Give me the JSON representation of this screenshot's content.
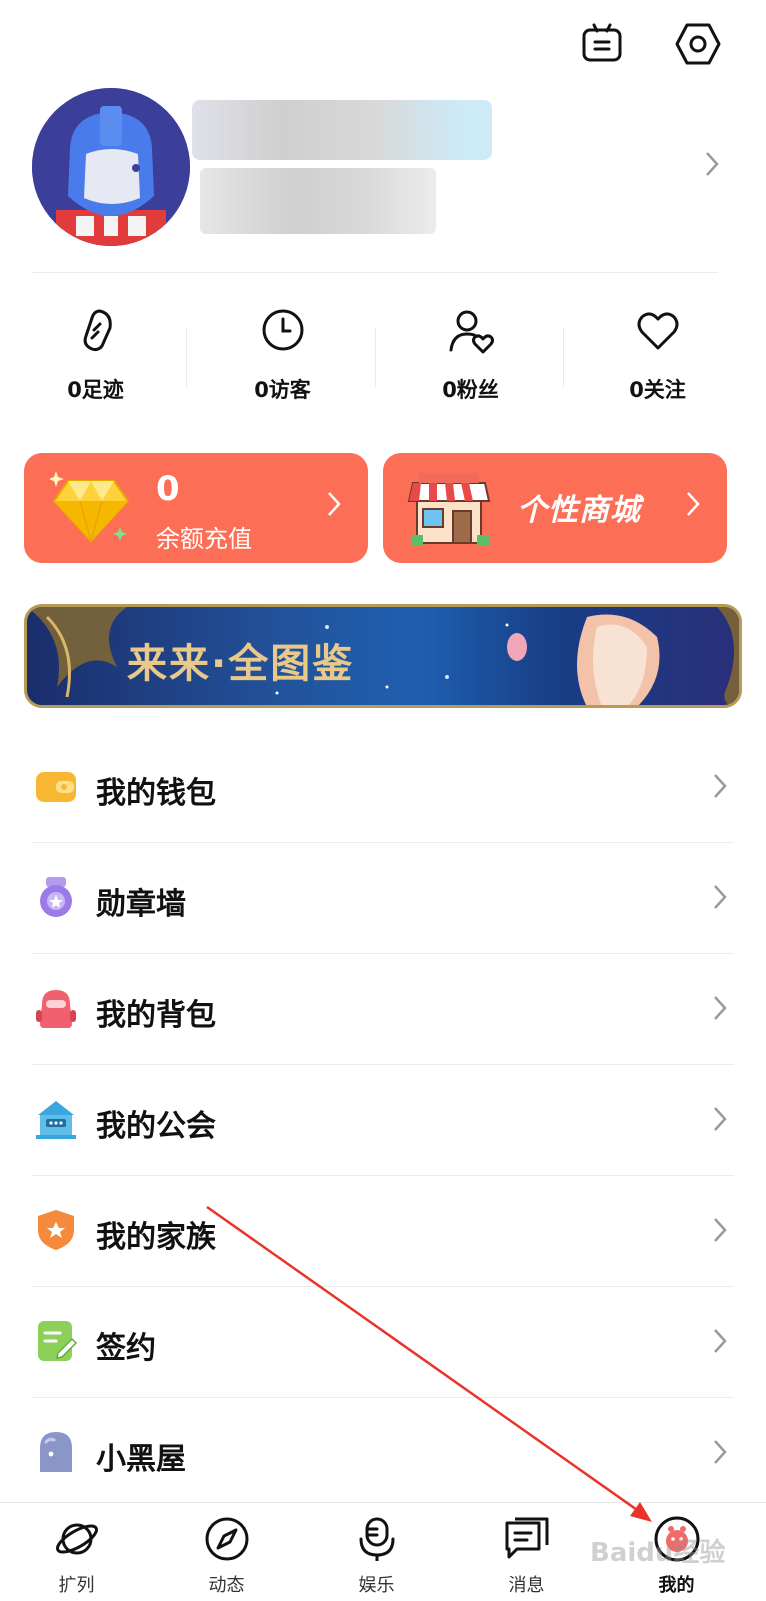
{
  "header": {
    "robot_icon": "robot-icon",
    "settings_icon": "hexagon-settings-icon"
  },
  "profile": {
    "avatar_icon": "transformer-avatar",
    "chevron": "›"
  },
  "stats": [
    {
      "icon": "footprint-icon",
      "label": "0足迹"
    },
    {
      "icon": "clock-icon",
      "label": "0访客"
    },
    {
      "icon": "user-heart-icon",
      "label": "0粉丝"
    },
    {
      "icon": "heart-icon",
      "label": "0关注"
    }
  ],
  "cards": {
    "balance": {
      "amount": "0",
      "label": "余额充值",
      "icon": "diamond-icon"
    },
    "shop": {
      "label": "个性商城",
      "icon": "storefront-icon"
    },
    "chevron": "›"
  },
  "banner": {
    "text": "来来·全图鉴"
  },
  "menu": [
    {
      "label": "我的钱包",
      "icon": "wallet-icon",
      "color": "#f7b733"
    },
    {
      "label": "勋章墙",
      "icon": "medal-icon",
      "color": "#9b7be8"
    },
    {
      "label": "我的背包",
      "icon": "backpack-icon",
      "color": "#f0606e"
    },
    {
      "label": "我的公会",
      "icon": "guild-icon",
      "color": "#3aa6e0"
    },
    {
      "label": "我的家族",
      "icon": "shield-icon",
      "color": "#f58a3c"
    },
    {
      "label": "签约",
      "icon": "sign-doc-icon",
      "color": "#8cd05a"
    },
    {
      "label": "小黑屋",
      "icon": "jail-icon",
      "color": "#8a96c8"
    }
  ],
  "menu_chevron": "›",
  "tabbar": [
    {
      "label": "扩列",
      "icon": "planet-icon"
    },
    {
      "label": "动态",
      "icon": "compass-icon"
    },
    {
      "label": "娱乐",
      "icon": "microphone-icon"
    },
    {
      "label": "消息",
      "icon": "chat-icon"
    },
    {
      "label": "我的",
      "icon": "profile-face-icon",
      "active": true
    }
  ],
  "watermark": "Baidu经验"
}
